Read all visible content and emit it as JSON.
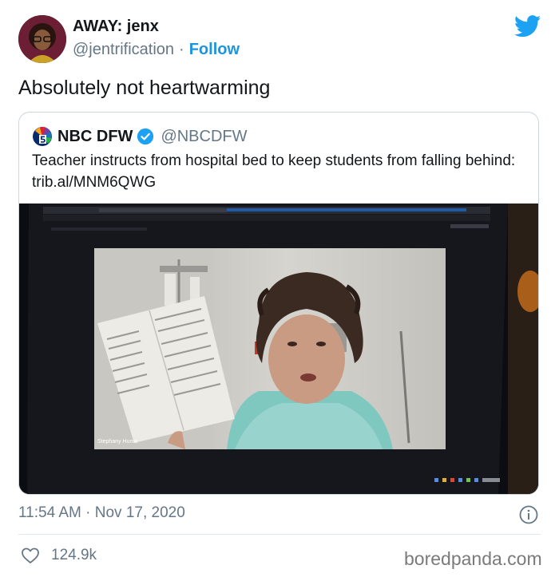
{
  "author": {
    "name": "AWAY: jenx",
    "handle": "@jentrification",
    "separator": "·",
    "follow_label": "Follow"
  },
  "tweet": {
    "text": "Absolutely not heartwarming",
    "timestamp": "11:54 AM · Nov 17, 2020",
    "like_count": "124.9k"
  },
  "quoted": {
    "name": "NBC DFW",
    "handle": "@NBCDFW",
    "text": "Teacher instructs from hospital bed to keep students from falling behind: trib.al/MNM6QWG",
    "media": {
      "video_caption": "Stephany Hume"
    }
  },
  "watermark": "boredpanda.com",
  "icons": {
    "brand": "twitter-bird-icon",
    "verified": "verified-badge-icon",
    "info": "info-icon",
    "like": "heart-icon"
  },
  "colors": {
    "link_blue": "#1b95e0",
    "twitter_blue": "#1da1f2",
    "muted_gray": "#657786",
    "text": "#14171a"
  }
}
